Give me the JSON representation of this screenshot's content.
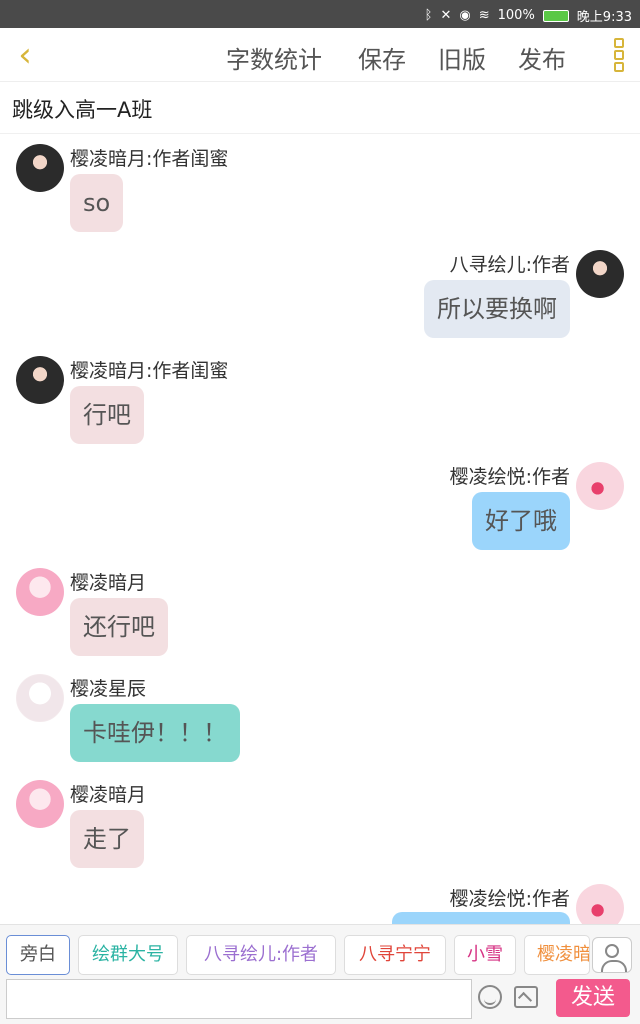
{
  "status_bar": {
    "icons": [
      "bluetooth-icon",
      "mute-icon",
      "eye-icon",
      "wifi-icon"
    ],
    "battery": "100%",
    "time": "晚上9:33"
  },
  "top_bar": {
    "back_icon": "back-chevron-icon",
    "items": [
      {
        "label": "字数统计"
      },
      {
        "label": "保存"
      },
      {
        "label": "旧版"
      },
      {
        "label": "发布"
      }
    ],
    "more_icon": "more-icon",
    "accent_color": "#d7b53a"
  },
  "title": "跳级入高一A班",
  "messages": [
    {
      "name": "樱凌暗月:作者闺蜜",
      "text": "so",
      "side": "left",
      "bubble": "pink",
      "avatar": "dark"
    },
    {
      "name": "八寻绘儿:作者",
      "text": "所以要换啊",
      "side": "right",
      "bubble": "gray",
      "avatar": "dark"
    },
    {
      "name": "樱凌暗月:作者闺蜜",
      "text": "行吧",
      "side": "left",
      "bubble": "pink",
      "avatar": "dark"
    },
    {
      "name": "樱凌绘悦:作者",
      "text": "好了哦",
      "side": "right",
      "bubble": "blue",
      "avatar": "heart"
    },
    {
      "name": "樱凌暗月",
      "text": "还行吧",
      "side": "left",
      "bubble": "pink",
      "avatar": "pink"
    },
    {
      "name": "樱凌星辰",
      "text": "卡哇伊！！！",
      "side": "left",
      "bubble": "teal",
      "avatar": "white"
    },
    {
      "name": "樱凌暗月",
      "text": "走了",
      "side": "left",
      "bubble": "pink",
      "avatar": "pink"
    },
    {
      "name": "樱凌绘悦:作者",
      "text": "",
      "side": "right",
      "bubble": "blue",
      "avatar": "heart"
    }
  ],
  "roles": [
    {
      "label": "旁白",
      "color": "#555555",
      "selected": true
    },
    {
      "label": "绘群大号",
      "color": "#2bb3a3",
      "selected": false
    },
    {
      "label": "八寻绘儿:作者",
      "color": "#9b6fd0",
      "selected": false
    },
    {
      "label": "八寻宁宁",
      "color": "#e0453a",
      "selected": false
    },
    {
      "label": "小雪",
      "color": "#d63384",
      "selected": false
    },
    {
      "label": "樱凌暗",
      "color": "#f0903e",
      "selected": false
    }
  ],
  "composer": {
    "placeholder": "",
    "send_label": "发送",
    "emoji_icon": "emoji-icon",
    "image_icon": "image-icon",
    "user_icon": "user-icon",
    "send_color": "#f35a8d"
  }
}
